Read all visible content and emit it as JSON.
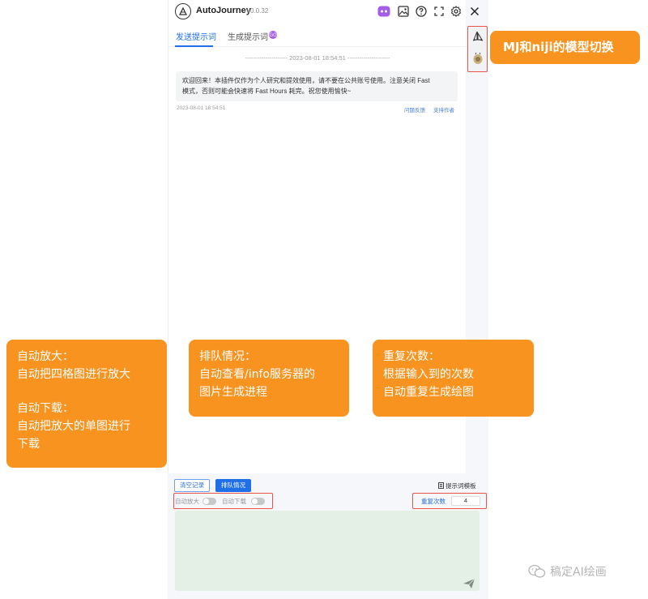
{
  "app": {
    "name": "AutoJourney",
    "version": "v0.0.32"
  },
  "header_icons": [
    "discord-icon",
    "image-icon",
    "help-icon",
    "fullscreen-icon",
    "settings-icon",
    "close-icon"
  ],
  "tabs": [
    {
      "label": "发送提示词",
      "active": true
    },
    {
      "label": "生成提示词",
      "badge": "GO"
    }
  ],
  "chat": {
    "separator": "--------------------- 2023-08-01 18:54:51 ---------------------",
    "welcome_line1": "欢迎回来！本插件仅作为个人研究和提效使用，请不要在公共账号使用。注意关闭 Fast",
    "welcome_line2": "模式，否则可能会快速将 Fast Hours 耗完。祝您使用愉快~",
    "timestamp": "2023-08-01 18:54:51",
    "feedback_link": "问题反馈",
    "support_link": "支持作者"
  },
  "models": [
    "midjourney-icon",
    "niji-icon"
  ],
  "controls": {
    "clear_label": "清空记录",
    "queue_label": "排队情况",
    "template_label": "提示词模板",
    "auto_upscale_label": "自动放大",
    "auto_download_label": "自动下载",
    "repeat_label": "重复次数",
    "repeat_value": "4"
  },
  "callouts": {
    "model": "MJ和niji的模型切换",
    "auto_line1": "自动放大：",
    "auto_line2": "自动把四格图进行放大",
    "auto_line3": "自动下载：",
    "auto_line4": "自动把放大的单图进行",
    "auto_line5": "下载",
    "queue_line1": "排队情况：",
    "queue_line2": "自动查看/info服务器的",
    "queue_line3": "图片生成进程",
    "repeat_line1": "重复次数：",
    "repeat_line2": "根据输入到的次数",
    "repeat_line3": "自动重复生成绘图"
  },
  "watermark": "稿定AI绘画",
  "colors": {
    "accent": "#1f6fe8",
    "callout": "#f7931e",
    "highlight_border": "#e8534a",
    "prompt_bg": "#e4efe5"
  }
}
